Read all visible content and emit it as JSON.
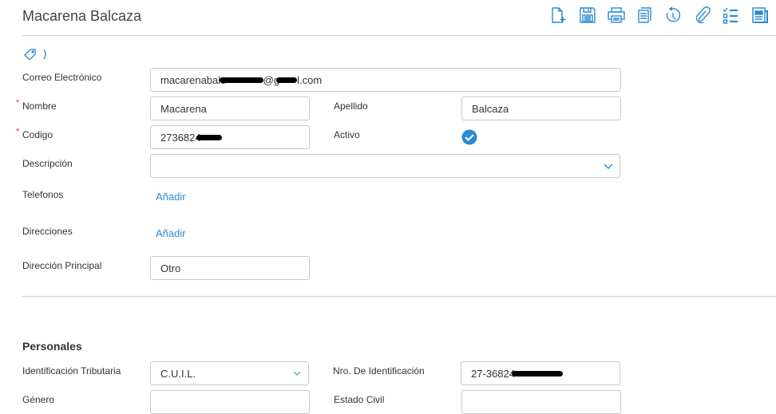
{
  "header": {
    "title": "Macarena Balcaza"
  },
  "toolbar": {
    "icons": [
      "new-document-icon",
      "save-icon",
      "print-icon",
      "copy-icon",
      "history-icon",
      "attachment-icon",
      "checklist-icon",
      "report-icon"
    ]
  },
  "colors": {
    "accent": "#2a8ad4",
    "required": "#dd3333"
  },
  "form": {
    "email_label": "Correo Electrónico",
    "email_prefix": "macarenabalc",
    "email_mid": "@g",
    "email_suffix": "l.com",
    "nombre_label": "Nombre",
    "nombre_value": "Macarena",
    "apellido_label": "Apellido",
    "apellido_value": "Balcaza",
    "codigo_label": "Codigo",
    "codigo_value": "2736824",
    "activo_label": "Activo",
    "activo_checked": true,
    "descripcion_label": "Descripción",
    "descripcion_value": "",
    "telefonos_label": "Telefonos",
    "telefonos_add": "Añadir",
    "direcciones_label": "Direcciones",
    "direcciones_add": "Añadir",
    "direccion_principal_label": "Dirección Principal",
    "direccion_principal_value": "Otro"
  },
  "personales": {
    "title": "Personales",
    "id_trib_label": "Identificación Tributaria",
    "id_trib_value": "C.U.I.L.",
    "nro_id_label": "Nro. De Identificación",
    "nro_id_value": "27-36824",
    "genero_label": "Género",
    "estado_civil_label": "Estado Civil"
  }
}
